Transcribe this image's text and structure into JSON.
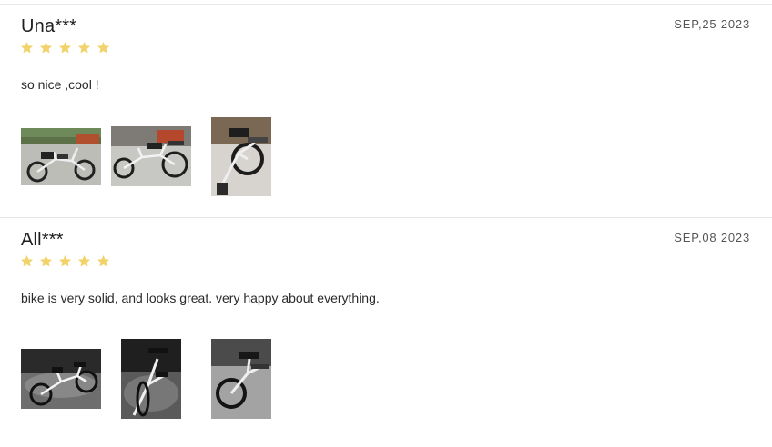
{
  "reviews": [
    {
      "reviewer": "Una***",
      "date": "SEP,25 2023",
      "rating": 5,
      "comment": "so nice ,cool !",
      "photos": [
        "photo-bike-with-child-seats-outdoor",
        "photo-bike-side-view-outdoor",
        "photo-bike-closeup-rear"
      ]
    },
    {
      "reviewer": "All***",
      "date": "SEP,08 2023",
      "rating": 5,
      "comment": "bike is very solid, and looks great. very happy about everything.",
      "photos": [
        "photo-bike-night-floor",
        "photo-bike-front-angle",
        "photo-bike-rear-angle-indoor"
      ]
    }
  ],
  "colors": {
    "star": "#f2d36b",
    "divider": "#e6e6e6",
    "date": "#555555"
  },
  "icons": {
    "rating": "star-icon"
  }
}
